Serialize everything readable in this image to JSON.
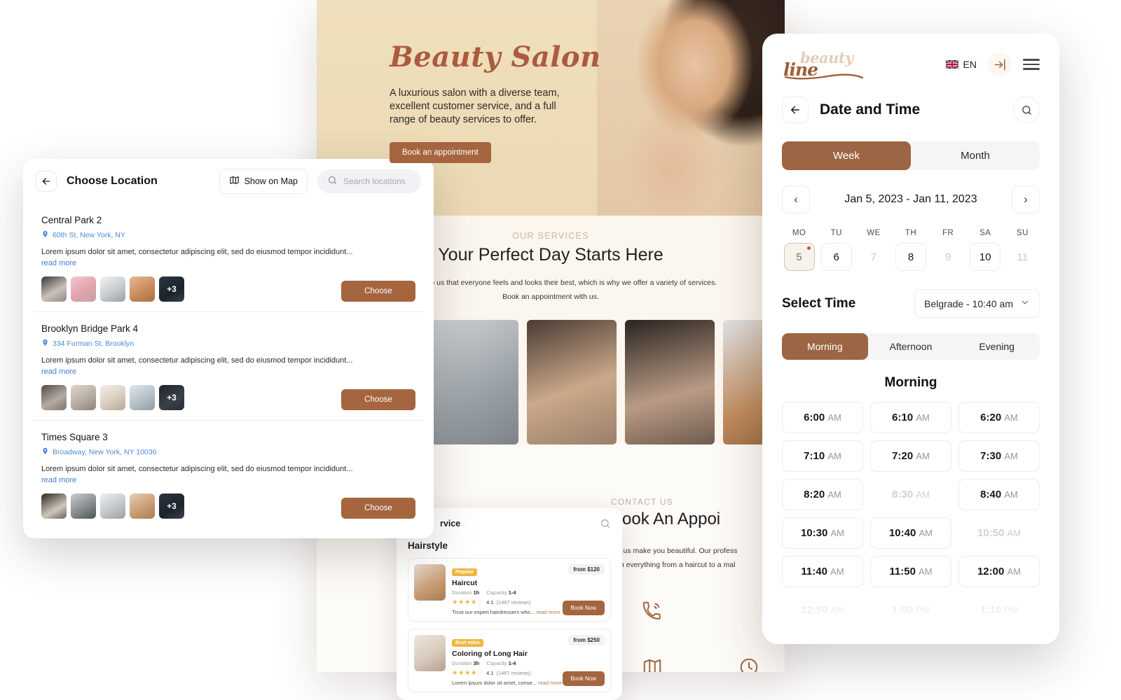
{
  "website": {
    "hero": {
      "title": "Beauty Salon",
      "subtitle": "A luxurious salon with a diverse team, excellent customer service, and a full range of beauty services to offer.",
      "cta": "Book an appointment"
    },
    "services_section": {
      "kicker": "OUR SERVICES",
      "title": "Your Perfect Day Starts Here",
      "desc_line1": "It's important to us that everyone feels and looks their best, which is why we offer a variety of services.",
      "desc_line2": "Book an appointment with us."
    },
    "contact_section": {
      "kicker": "CONTACT US",
      "title": "Book An Appoi",
      "desc_line1": "Let us make you beautiful. Our profess",
      "desc_line2": "with everything from a haircut to a mal",
      "icons": [
        "phone-ring-icon",
        "map-icon",
        "clock-icon"
      ]
    }
  },
  "service_panel": {
    "header_title": "rvice",
    "group_title": "Hairstyle",
    "items": [
      {
        "badge": "Popular",
        "name": "Haircut",
        "duration_label": "Duration",
        "duration": "1h",
        "capacity_label": "Capacity",
        "capacity": "1-4",
        "rating": "4.1",
        "reviews": "(1467 reviews)",
        "desc": "Trust our expert hairdressers who...",
        "read_more": "read more",
        "price": "from $120",
        "book": "Book Now"
      },
      {
        "badge": "Best value",
        "name": "Coloring of Long Hair",
        "duration_label": "Duration",
        "duration": "3h",
        "capacity_label": "Capacity",
        "capacity": "1-4",
        "rating": "4.1",
        "reviews": "(1467 reviews)",
        "desc": "Lorem ipsum dolor sit amet, conse...",
        "read_more": "read more",
        "price": "from $250",
        "book": "Book Now"
      }
    ]
  },
  "location_panel": {
    "title": "Choose Location",
    "map_button": "Show on Map",
    "search_placeholder": "Search locations",
    "read_more": "read more",
    "choose_label": "Choose",
    "items": [
      {
        "name": "Central Park 2",
        "address": "60th St, New York, NY",
        "description": "Lorem ipsum dolor sit amet, consectetur adipiscing elit, sed do eiusmod tempor incididunt...",
        "extra_count": "+3"
      },
      {
        "name": "Brooklyn Bridge Park 4",
        "address": "334 Furman St, Brooklyn",
        "description": "Lorem ipsum dolor sit amet, consectetur adipiscing elit, sed do eiusmod tempor incididunt...",
        "extra_count": "+3"
      },
      {
        "name": "Times Square 3",
        "address": "Broadway, New York, NY 10036",
        "description": "Lorem ipsum dolor sit amet, consectetur adipiscing elit, sed do eiusmod tempor incididunt...",
        "extra_count": "+3"
      }
    ]
  },
  "datetime_panel": {
    "brand": {
      "word1": "beauty",
      "word2": "line"
    },
    "language": "EN",
    "title": "Date and Time",
    "view_tabs": [
      {
        "label": "Week",
        "active": true
      },
      {
        "label": "Month",
        "active": false
      }
    ],
    "week_range": "Jan 5, 2023 - Jan 11, 2023",
    "prev_label": "‹",
    "next_label": "›",
    "day_headers": [
      "MO",
      "TU",
      "WE",
      "TH",
      "FR",
      "SA",
      "SU"
    ],
    "days": [
      {
        "num": "5",
        "state": "selected"
      },
      {
        "num": "6",
        "state": "available"
      },
      {
        "num": "7",
        "state": "disabled"
      },
      {
        "num": "8",
        "state": "available"
      },
      {
        "num": "9",
        "state": "disabled"
      },
      {
        "num": "10",
        "state": "available"
      },
      {
        "num": "11",
        "state": "disabled"
      }
    ],
    "select_time_label": "Select Time",
    "timezone": "Belgrade - 10:40 am",
    "daypart_tabs": [
      {
        "label": "Morning",
        "active": true
      },
      {
        "label": "Afternoon",
        "active": false
      },
      {
        "label": "Evening",
        "active": false
      }
    ],
    "slot_group_title": "Morning",
    "slots": [
      {
        "time": "6:00",
        "mer": "AM",
        "state": "available"
      },
      {
        "time": "6:10",
        "mer": "AM",
        "state": "available"
      },
      {
        "time": "6:20",
        "mer": "AM",
        "state": "available"
      },
      {
        "time": "7:10",
        "mer": "AM",
        "state": "available"
      },
      {
        "time": "7:20",
        "mer": "AM",
        "state": "available"
      },
      {
        "time": "7:30",
        "mer": "AM",
        "state": "available"
      },
      {
        "time": "8:20",
        "mer": "AM",
        "state": "available"
      },
      {
        "time": "8:30",
        "mer": "AM",
        "state": "disabled"
      },
      {
        "time": "8:40",
        "mer": "AM",
        "state": "available"
      },
      {
        "time": "10:30",
        "mer": "AM",
        "state": "available"
      },
      {
        "time": "10:40",
        "mer": "AM",
        "state": "available"
      },
      {
        "time": "10:50",
        "mer": "AM",
        "state": "disabled"
      },
      {
        "time": "11:40",
        "mer": "AM",
        "state": "available"
      },
      {
        "time": "11:50",
        "mer": "AM",
        "state": "available"
      },
      {
        "time": "12:00",
        "mer": "AM",
        "state": "available"
      },
      {
        "time": "12:50",
        "mer": "AM",
        "state": "ghost"
      },
      {
        "time": "1:00",
        "mer": "PM",
        "state": "ghost"
      },
      {
        "time": "1:10",
        "mer": "PM",
        "state": "ghost"
      }
    ]
  },
  "colors": {
    "accent_brown": "#9c6644",
    "button_brown": "#a4653f",
    "hero_cream": "#efdcb8",
    "link_blue": "#3e7fd0",
    "badge_gold": "#f0b642"
  }
}
